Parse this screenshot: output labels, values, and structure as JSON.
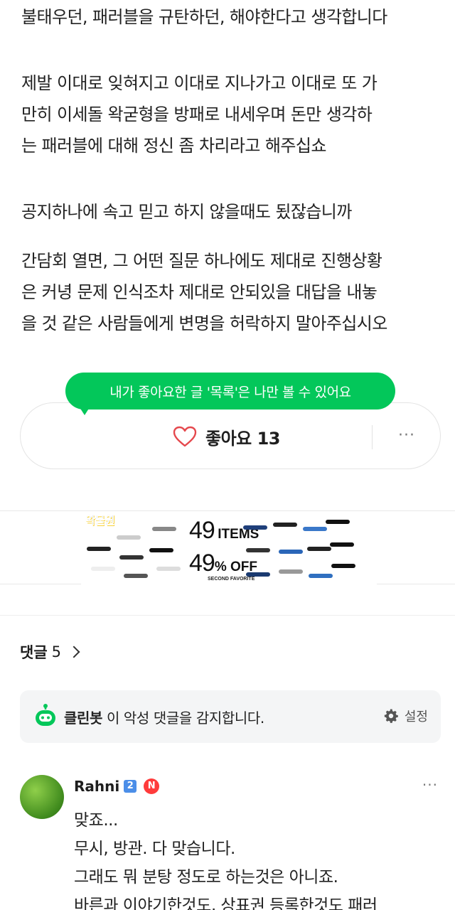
{
  "article": {
    "p1": "불태우던, 패러블을 규탄하던, 해야한다고 생각합니다",
    "p2_lines": [
      "제발 이대로 잊혀지고 이대로 지나가고 이대로 또 가",
      "만히 이세돌 왁굳형을 방패로 내세우며 돈만 생각하",
      "는 패러블에 대해 정신 좀 차리라고 해주십쇼"
    ],
    "p3": "공지하나에 속고 믿고 하지 않을때도 됬잖습니까",
    "p4_lines": [
      "간담회 열면, 그 어떤 질문 하나에도 제대로 진행상황",
      "은 커녕 문제 인식조차 제대로 안되있을 대답을 내놓",
      "을 것 같은 사람들에게 변명을 허락하지 말아주십시오"
    ]
  },
  "tooltip": {
    "text": "내가 좋아요한 글 '목록'은 나만 볼 수 있어요"
  },
  "like": {
    "label": "좋아요 13",
    "icon": "heart-outline-icon",
    "more": "···"
  },
  "banner": {
    "logo": "왁물원",
    "items_num": "49",
    "items_word": "ITEMS",
    "off_num": "49",
    "off_word": "% OFF",
    "sub": "SECOND FAVORITE"
  },
  "comments": {
    "title": "댓글",
    "count": "5"
  },
  "cleanbot": {
    "name": "클린봇",
    "text": " 이 악성 댓글을 감지합니다.",
    "setting": "설정"
  },
  "comment": {
    "author": "Rahni",
    "level": "2",
    "badge": "N",
    "more": "···",
    "lines": [
      "맞죠...",
      "무시, 방관. 다 맞습니다.",
      "그래도 뭐 분탕 정도로 하는것은 아니죠.",
      "바른과 이야기한것도, 상표권 등록한것도 패러"
    ]
  },
  "colors": {
    "accent_green": "#03c75a",
    "heart": "#e5484d",
    "badge_red": "#ff3b3b",
    "level_blue": "#4b8ee8"
  }
}
